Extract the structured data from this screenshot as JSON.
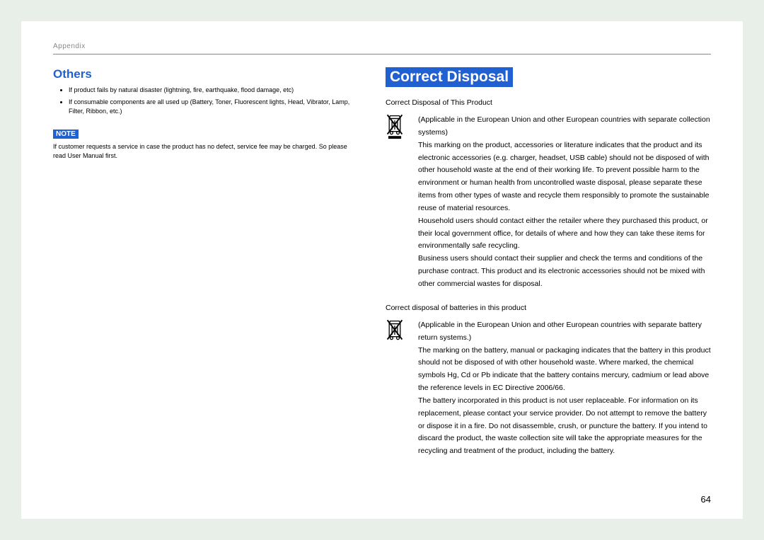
{
  "header": {
    "label": "Appendix"
  },
  "left": {
    "heading": "Others",
    "bullets": [
      "If product fails by natural disaster (lightning, fire, earthquake, flood damage, etc)",
      "If consumable components are all used up (Battery, Toner, Fluorescent lights, Head, Vibrator, Lamp, Filter, Ribbon, etc.)"
    ],
    "note_label": "NOTE",
    "note_text": "If customer requests a service in case the product has no defect, service fee may be charged. So please read User Manual first."
  },
  "right": {
    "heading": "Correct Disposal",
    "sub1": "Correct Disposal of This Product",
    "p1a": "(Applicable in the European Union and other European countries with separate collection systems)",
    "p1b": "This marking on the product, accessories or literature indicates that the product and its electronic accessories (e.g. charger, headset, USB cable) should not be disposed of with other household waste at the end of their working life. To prevent possible harm to the environment or human health from uncontrolled waste disposal, please separate these items from other types of waste and recycle them responsibly to promote the sustainable reuse of material resources.",
    "p1c": "Household users should contact either the retailer where they purchased this product, or their local government office, for details of where and how they can take these items for environmentally safe recycling.",
    "p1d": "Business users should contact their supplier and check the terms and conditions of the purchase contract. This product and its electronic accessories should not be mixed with other commercial wastes for disposal.",
    "sub2": "Correct disposal of batteries in this product",
    "p2a": "(Applicable in the European Union and other European countries with separate battery return systems.)",
    "p2b": "The marking on the battery, manual or packaging indicates that the battery in this product should not be disposed of with other household waste. Where marked, the chemical symbols Hg, Cd or Pb indicate that the battery contains mercury, cadmium or lead above the reference levels in EC Directive 2006/66.",
    "p2c": "The battery incorporated in this product is not user replaceable. For information on its replacement, please contact your service provider. Do not attempt to remove the battery or dispose it in a fire. Do not disassemble, crush, or puncture the battery. If you intend to discard the product, the waste collection site will take the appropriate measures for the recycling and treatment of the product, including the battery."
  },
  "page_number": "64"
}
